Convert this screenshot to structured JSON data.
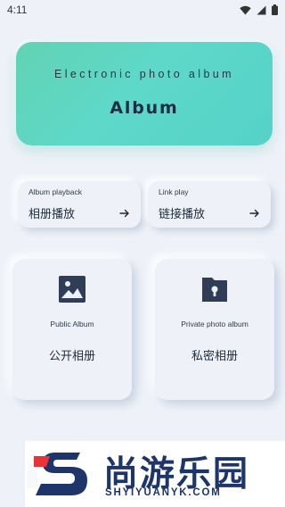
{
  "status_bar": {
    "time": "4:11",
    "icons": [
      "wifi-icon",
      "signal-icon",
      "battery-icon"
    ]
  },
  "banner": {
    "subtitle": "Electronic photo album",
    "title": "Album",
    "gradient_start": "#62d3b4",
    "gradient_end": "#55d2c8"
  },
  "play_buttons": [
    {
      "label_en": "Album playback",
      "label_cn": "相册播放",
      "icon": "arrow-right-icon"
    },
    {
      "label_en": "Link play",
      "label_cn": "链接播放",
      "icon": "arrow-right-icon"
    }
  ],
  "albums": [
    {
      "label_en": "Public Album",
      "label_cn": "公开相册",
      "icon": "image-icon"
    },
    {
      "label_en": "Private photo album",
      "label_cn": "私密相册",
      "icon": "locked-folder-icon"
    }
  ],
  "watermark": {
    "brand_cn": "尚游乐园",
    "brand_en": "SHYIYUANYK.COM",
    "brand_color": "#1d3568",
    "accent_color": "#e8333a"
  },
  "colors": {
    "background": "#eef2f8",
    "icon": "#2f3e56"
  }
}
